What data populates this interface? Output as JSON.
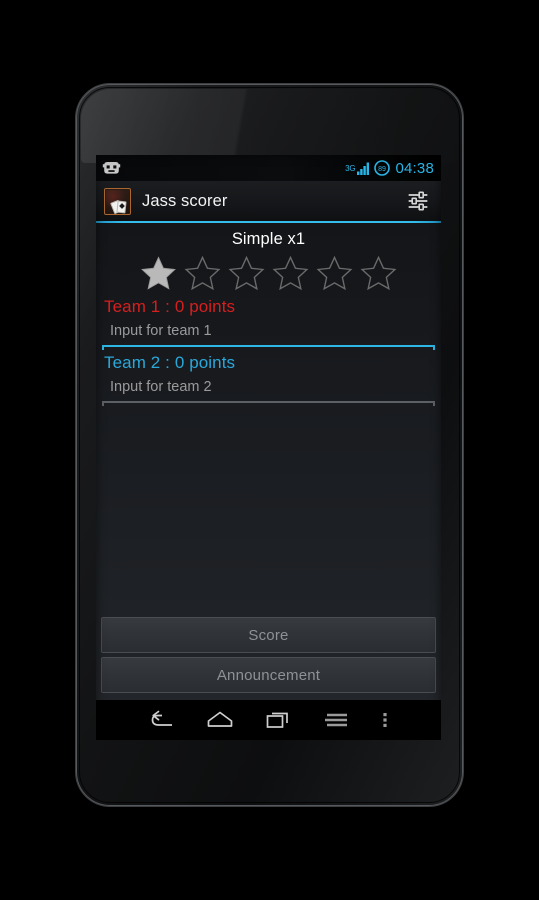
{
  "status_bar": {
    "logo_icon": "cyanogenmod-logo-icon",
    "network_type": "3G",
    "signal_icon": "signal-bars-icon",
    "battery_level": "89",
    "battery_icon": "battery-circle-icon",
    "time": "04:38",
    "accent_color": "#29b6e8"
  },
  "action_bar": {
    "app_icon": "jass-cards-app-icon",
    "title": "Jass scorer",
    "settings_icon": "sliders-settings-icon",
    "divider_color": "#34bdeb"
  },
  "main": {
    "mode_title": "Simple x1",
    "rating": {
      "icon": "star-icon",
      "total": 6,
      "filled": 1,
      "filled_color": "#b9b9b9",
      "empty_color": "#6b6b6b"
    },
    "teams": [
      {
        "label": "Team 1 : 0 points",
        "color": "#d61f1f",
        "input_value": "",
        "input_placeholder": "Input for team 1",
        "focused": true,
        "underline_color": "#2eb6e4"
      },
      {
        "label": "Team 2 : 0 points",
        "color": "#2ba8da",
        "input_value": "",
        "input_placeholder": "Input for team 2",
        "focused": false,
        "underline_color": "#5d6165"
      }
    ],
    "buttons": [
      {
        "label": "Score",
        "name": "score-button"
      },
      {
        "label": "Announcement",
        "name": "announcement-button"
      }
    ]
  },
  "nav_bar": {
    "back_icon": "back-arrow-icon",
    "home_icon": "home-icon",
    "recents_icon": "recent-apps-icon",
    "menu_icon": "menu-lines-icon",
    "overflow_icon": "overflow-dots-icon"
  }
}
